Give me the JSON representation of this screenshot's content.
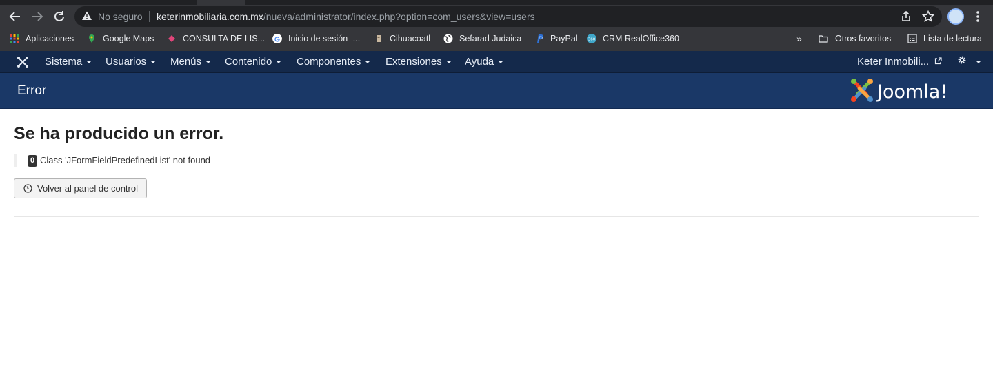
{
  "browser": {
    "security_label": "No seguro",
    "url_host": "keterinmobiliaria.com.mx",
    "url_path": "/nueva/administrator/index.php?option=com_users&view=users",
    "bookmarks": [
      {
        "label": "Aplicaciones",
        "icon": "apps-grid-icon",
        "color": "#ea4335"
      },
      {
        "label": "Google Maps",
        "icon": "maps-pin-icon",
        "color": "#34a853"
      },
      {
        "label": "CONSULTA DE LIS...",
        "icon": "diamond-icon",
        "color": "#e1457a"
      },
      {
        "label": "Inicio de sesión -...",
        "icon": "google-icon",
        "color": "#4285f4"
      },
      {
        "label": "Cihuacoatl",
        "icon": "figure-icon",
        "color": "#c9b8a0"
      },
      {
        "label": "Sefarad Judaica",
        "icon": "globe-icon",
        "color": "#ffffff"
      },
      {
        "label": "PayPal",
        "icon": "paypal-icon",
        "color": "#2b6ed3"
      },
      {
        "label": "CRM RealOffice360",
        "icon": "crm-360-icon",
        "color": "#3fa6c9"
      }
    ],
    "overflow": "»",
    "other_bookmarks": "Otros favoritos",
    "reading_list": "Lista de lectura"
  },
  "admin_nav": {
    "menus": [
      "Sistema",
      "Usuarios",
      "Menús",
      "Contenido",
      "Componentes",
      "Extensiones",
      "Ayuda"
    ],
    "site_name": "Keter Inmobili..."
  },
  "header": {
    "title": "Error",
    "brand": "Joomla!"
  },
  "error": {
    "heading": "Se ha producido un error.",
    "code": "0",
    "message": "Class 'JFormFieldPredefinedList' not found",
    "back_button": "Volver al panel de control"
  },
  "colors": {
    "nav_bg": "#14294b",
    "header_bg": "#1a3867",
    "chrome_bg": "#35363a"
  }
}
